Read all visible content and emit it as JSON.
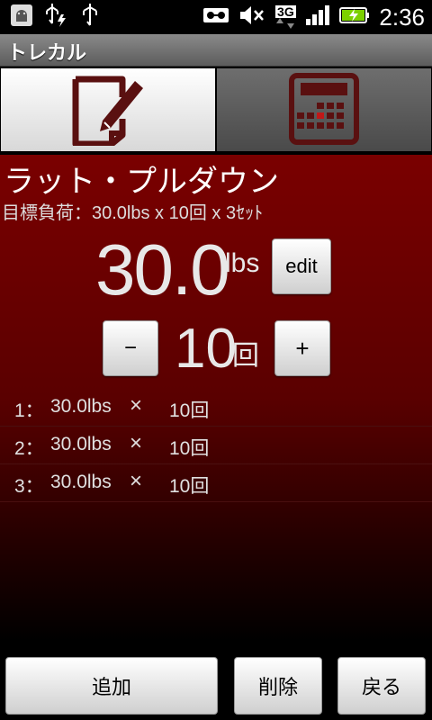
{
  "status_bar": {
    "left_icons": [
      "android-debug-icon",
      "usb-charge-icon",
      "usb-icon"
    ],
    "right_icons": [
      "voicemail-icon",
      "mute-icon",
      "3g-icon",
      "signal-icon",
      "battery-charging-icon"
    ],
    "network": "3G",
    "time": "2:36"
  },
  "app": {
    "title": "トレカル"
  },
  "tabs": [
    {
      "name": "record",
      "icon": "pencil-note-icon",
      "active": true
    },
    {
      "name": "calendar",
      "icon": "calendar-icon",
      "active": false
    }
  ],
  "exercise": {
    "name": "ラット・プルダウン",
    "target": "目標負荷：30.0lbs x 10回 x 3ｾｯﾄ"
  },
  "weight": {
    "value": "30.0",
    "unit": "lbs",
    "edit_label": "edit"
  },
  "reps": {
    "value": "10",
    "unit": "回",
    "minus_label": "−",
    "plus_label": "+"
  },
  "sets": [
    {
      "index": "1：",
      "weight": "30.0lbs",
      "times": "×",
      "reps": "10回"
    },
    {
      "index": "2：",
      "weight": "30.0lbs",
      "times": "×",
      "reps": "10回"
    },
    {
      "index": "3：",
      "weight": "30.0lbs",
      "times": "×",
      "reps": "10回"
    }
  ],
  "buttons": {
    "add": "追加",
    "delete": "削除",
    "back": "戻る"
  },
  "colors": {
    "accent_dark_red": "#7a0000",
    "icon_maroon": "#5a1010",
    "calendar_highlight": "#c01818"
  }
}
